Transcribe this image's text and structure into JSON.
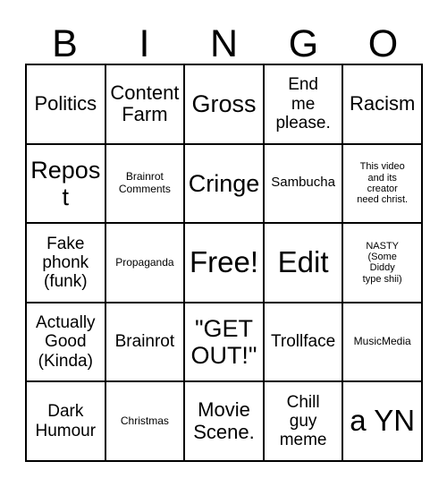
{
  "card": {
    "title": "BINGO",
    "header_letters": [
      "B",
      "I",
      "N",
      "G",
      "O"
    ],
    "colors": {
      "background": "#ffffff",
      "text": "#000000",
      "border": "#000000"
    },
    "grid_size": "5x5",
    "cells": [
      {
        "text": "Politics",
        "size": "lg",
        "row": 1,
        "col": 1,
        "column_letter": "B",
        "free_space": false
      },
      {
        "text": "Content\nFarm",
        "size": "lg",
        "row": 1,
        "col": 2,
        "column_letter": "I",
        "free_space": false
      },
      {
        "text": "Gross",
        "size": "xl",
        "row": 1,
        "col": 3,
        "column_letter": "N",
        "free_space": false
      },
      {
        "text": "End\nme\nplease.",
        "size": "md",
        "row": 1,
        "col": 4,
        "column_letter": "G",
        "free_space": false
      },
      {
        "text": "Racism",
        "size": "lg",
        "row": 1,
        "col": 5,
        "column_letter": "O",
        "free_space": false
      },
      {
        "text": "Repost",
        "size": "xl",
        "row": 2,
        "col": 1,
        "column_letter": "B",
        "free_space": false
      },
      {
        "text": "Brainrot\nComments",
        "size": "xs",
        "row": 2,
        "col": 2,
        "column_letter": "I",
        "free_space": false
      },
      {
        "text": "Cringe",
        "size": "xl",
        "row": 2,
        "col": 3,
        "column_letter": "N",
        "free_space": false
      },
      {
        "text": "Sambucha",
        "size": "sm",
        "row": 2,
        "col": 4,
        "column_letter": "G",
        "free_space": false
      },
      {
        "text": "This video\nand its\ncreator\nneed christ.",
        "size": "xxs",
        "row": 2,
        "col": 5,
        "column_letter": "O",
        "free_space": false
      },
      {
        "text": "Fake\nphonk\n(funk)",
        "size": "md",
        "row": 3,
        "col": 1,
        "column_letter": "B",
        "free_space": false
      },
      {
        "text": "Propaganda",
        "size": "xs",
        "row": 3,
        "col": 2,
        "column_letter": "I",
        "free_space": false
      },
      {
        "text": "Free!",
        "size": "xxl",
        "row": 3,
        "col": 3,
        "column_letter": "N",
        "free_space": true
      },
      {
        "text": "Edit",
        "size": "xxl",
        "row": 3,
        "col": 4,
        "column_letter": "G",
        "free_space": false
      },
      {
        "text": "NASTY\n(Some\nDiddy\ntype shii)",
        "size": "xxs",
        "row": 3,
        "col": 5,
        "column_letter": "O",
        "free_space": false
      },
      {
        "text": "Actually\nGood\n(Kinda)",
        "size": "md",
        "row": 4,
        "col": 1,
        "column_letter": "B",
        "free_space": false
      },
      {
        "text": "Brainrot",
        "size": "md",
        "row": 4,
        "col": 2,
        "column_letter": "I",
        "free_space": false
      },
      {
        "text": "\"GET\nOUT!\"",
        "size": "xl",
        "row": 4,
        "col": 3,
        "column_letter": "N",
        "free_space": false
      },
      {
        "text": "Trollface",
        "size": "md",
        "row": 4,
        "col": 4,
        "column_letter": "G",
        "free_space": false
      },
      {
        "text": "MusicMedia",
        "size": "xs",
        "row": 4,
        "col": 5,
        "column_letter": "O",
        "free_space": false
      },
      {
        "text": "Dark\nHumour",
        "size": "md",
        "row": 5,
        "col": 1,
        "column_letter": "B",
        "free_space": false
      },
      {
        "text": "Christmas",
        "size": "xs",
        "row": 5,
        "col": 2,
        "column_letter": "I",
        "free_space": false
      },
      {
        "text": "Movie\nScene.",
        "size": "lg",
        "row": 5,
        "col": 3,
        "column_letter": "N",
        "free_space": false
      },
      {
        "text": "Chill\nguy\nmeme",
        "size": "md",
        "row": 5,
        "col": 4,
        "column_letter": "G",
        "free_space": false
      },
      {
        "text": "a YN",
        "size": "xxl",
        "row": 5,
        "col": 5,
        "column_letter": "O",
        "free_space": false
      }
    ]
  }
}
